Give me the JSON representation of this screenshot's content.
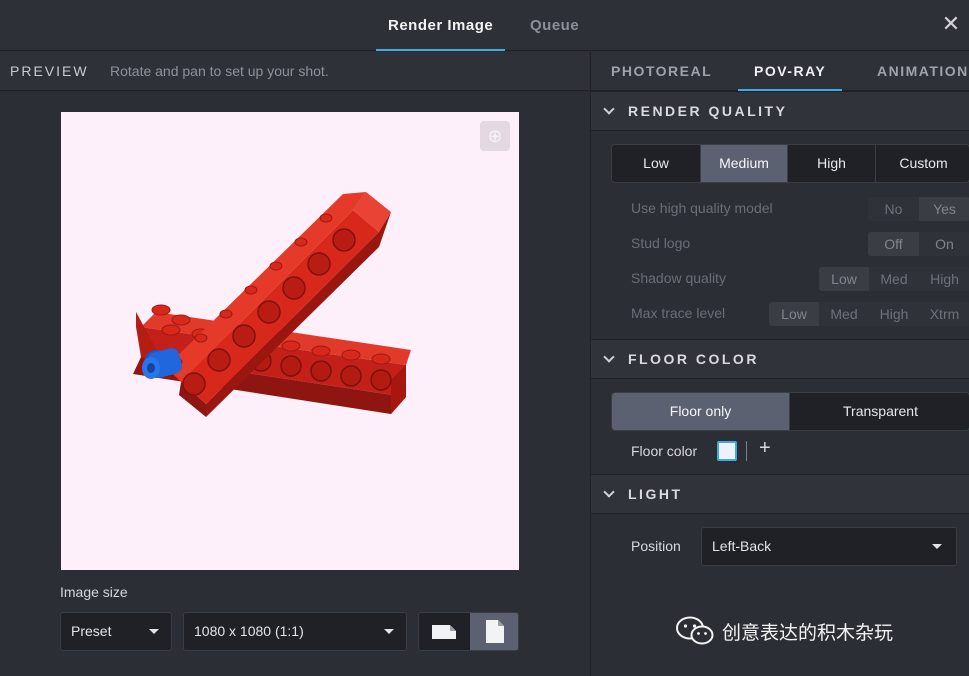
{
  "header": {
    "tabs": [
      {
        "label": "Render Image",
        "active": true
      },
      {
        "label": "Queue",
        "active": false
      }
    ],
    "close_icon": "close-icon"
  },
  "preview": {
    "title": "PREVIEW",
    "hint": "Rotate and pan to set up your shot.",
    "canvas_background": "#fdf0fb",
    "camera_icon": "camera-target-icon",
    "image_size_label": "Image size",
    "preset_value": "Preset",
    "resolution_value": "1080 x 1080 (1:1)",
    "orientation": {
      "options": [
        "landscape",
        "portrait"
      ],
      "selected": "portrait"
    }
  },
  "settings": {
    "tabs": [
      {
        "label": "PHOTOREAL",
        "active": false
      },
      {
        "label": "POV-RAY",
        "active": true
      },
      {
        "label": "ANIMATION",
        "active": false
      }
    ],
    "render_quality": {
      "title": "RENDER QUALITY",
      "options": [
        "Low",
        "Medium",
        "High",
        "Custom"
      ],
      "selected": "Medium",
      "rows": [
        {
          "label": "Use high quality model",
          "options": [
            "No",
            "Yes"
          ],
          "selected": "Yes"
        },
        {
          "label": "Stud logo",
          "options": [
            "Off",
            "On"
          ],
          "selected": "Off"
        },
        {
          "label": "Shadow quality",
          "options": [
            "Low",
            "Med",
            "High"
          ],
          "selected": "Low"
        },
        {
          "label": "Max trace level",
          "options": [
            "Low",
            "Med",
            "High",
            "Xtrm"
          ],
          "selected": "Low"
        }
      ]
    },
    "floor_color": {
      "title": "FLOOR COLOR",
      "options": [
        "Floor only",
        "Transparent"
      ],
      "selected": "Floor only",
      "color_label": "Floor color",
      "color_value": "#eef2ff",
      "add_symbol": "+"
    },
    "light": {
      "title": "LIGHT",
      "position_label": "Position",
      "position_value": "Left-Back"
    }
  },
  "watermark": {
    "text": "创意表达的积木杂玩",
    "icon": "wechat-icon"
  },
  "colors": {
    "accent": "#3fa9e0",
    "brick_red": "#d8281c",
    "pin_blue": "#1f5fd6"
  }
}
